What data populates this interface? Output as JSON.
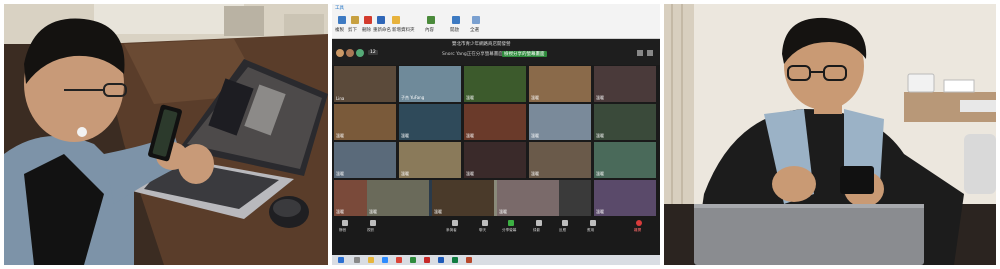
{
  "screen": {
    "ribbon_tab": "工具",
    "ribbon_groups": [
      "複製",
      "剪下",
      "刪除",
      "重新命名",
      "新增資料夾",
      "內容",
      "開啟",
      "全選"
    ],
    "meeting_title": "雙北市青少年網路商店開發營",
    "notice": "Snorc Yang正在分享螢幕畫面",
    "notice_button": "檢視分享的螢幕畫面",
    "participant_count": "12",
    "participants": [
      "Lina",
      "子杰 YuFang",
      "溫暖",
      "溫暖",
      "溫暖",
      "溫暖",
      "溫暖",
      "溫暖",
      "溫暖",
      "溫暖",
      "溫暖",
      "溫暖",
      "溫暖",
      "溫暖",
      "溫暖",
      "溫暖",
      "溫暖",
      "溫暖",
      "溫暖",
      "溫暖",
      "溫暖",
      "溫暖",
      "溫暖"
    ],
    "controls": [
      "靜音",
      "視訊",
      "參與者",
      "聊天",
      "分享螢幕",
      "錄影",
      "反應",
      "應用"
    ],
    "leave": "離開"
  }
}
